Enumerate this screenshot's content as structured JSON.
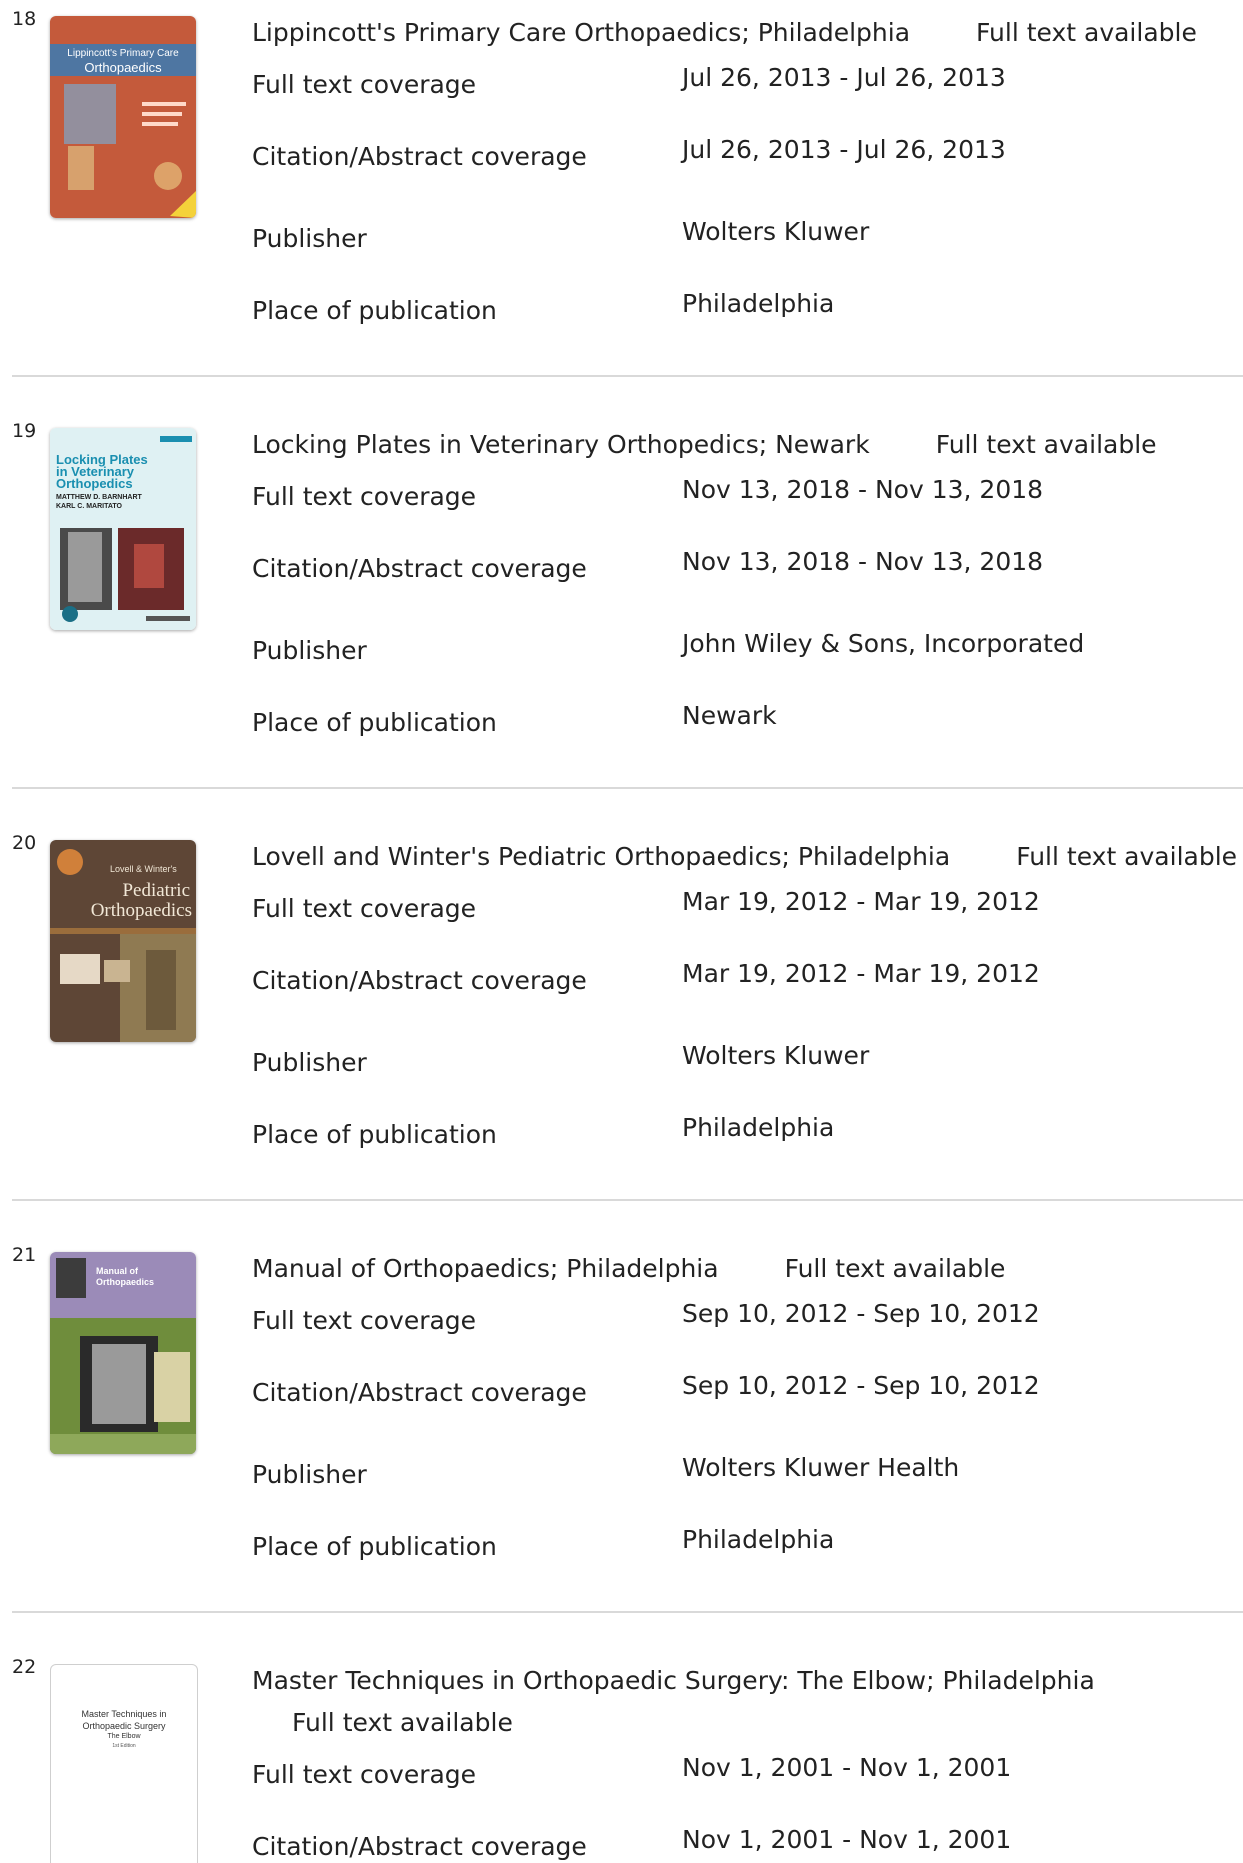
{
  "records": [
    {
      "number": "18",
      "title": "Lippincott's Primary Care Orthopaedics; Philadelphia",
      "availability": "Full text available",
      "fields": {
        "full_text_label": "Full text coverage",
        "full_text_value": "Jul 26, 2013 - Jul 26, 2013",
        "citation_label": "Citation/Abstract coverage",
        "citation_value": "Jul 26, 2013 - Jul 26, 2013",
        "publisher_label": "Publisher",
        "publisher_value": "Wolters Kluwer",
        "place_label": "Place of publication",
        "place_value": "Philadelphia"
      },
      "cover": {
        "line1": "Lippincott's Primary Care",
        "line2": "Orthopaedics",
        "colors": [
          "#c45a3b",
          "#2f6fa8"
        ]
      }
    },
    {
      "number": "19",
      "title": "Locking Plates in Veterinary Orthopedics; Newark",
      "availability": "Full text available",
      "fields": {
        "full_text_label": "Full text coverage",
        "full_text_value": "Nov 13, 2018 - Nov 13, 2018",
        "citation_label": "Citation/Abstract coverage",
        "citation_value": "Nov 13, 2018 - Nov 13, 2018",
        "publisher_label": "Publisher",
        "publisher_value": "John Wiley & Sons, Incorporated",
        "place_label": "Place of publication",
        "place_value": "Newark"
      },
      "cover": {
        "line1": "Locking Plates",
        "line2": "in Veterinary",
        "line3": "Orthopedics",
        "authors1": "MATTHEW D. BARNHART",
        "authors2": "KARL C. MARITATO",
        "colors": [
          "#dff1f3",
          "#1a8fb0"
        ]
      }
    },
    {
      "number": "20",
      "title": "Lovell and Winter's Pediatric Orthopaedics; Philadelphia",
      "availability": "Full text available",
      "fields": {
        "full_text_label": "Full text coverage",
        "full_text_value": "Mar 19, 2012 - Mar 19, 2012",
        "citation_label": "Citation/Abstract coverage",
        "citation_value": "Mar 19, 2012 - Mar 19, 2012",
        "publisher_label": "Publisher",
        "publisher_value": "Wolters Kluwer",
        "place_label": "Place of publication",
        "place_value": "Philadelphia"
      },
      "cover": {
        "line1": "Lovell & Winter's",
        "line2": "Pediatric",
        "line3": "Orthopaedics",
        "colors": [
          "#5e4636",
          "#8f7a52"
        ]
      }
    },
    {
      "number": "21",
      "title": "Manual of Orthopaedics; Philadelphia",
      "availability": "Full text available",
      "fields": {
        "full_text_label": "Full text coverage",
        "full_text_value": "Sep 10, 2012 - Sep 10, 2012",
        "citation_label": "Citation/Abstract coverage",
        "citation_value": "Sep 10, 2012 - Sep 10, 2012",
        "publisher_label": "Publisher",
        "publisher_value": "Wolters Kluwer Health",
        "place_label": "Place of publication",
        "place_value": "Philadelphia"
      },
      "cover": {
        "line1": "Manual of",
        "line2": "Orthopaedics",
        "colors": [
          "#9b8bb8",
          "#6f8d3c"
        ]
      }
    },
    {
      "number": "22",
      "title": "Master Techniques in Orthopaedic Surgery: The Elbow; Philadelphia",
      "availability": "Full text available",
      "fields": {
        "full_text_label": "Full text coverage",
        "full_text_value": "Nov 1, 2001 - Nov 1, 2001",
        "citation_label": "Citation/Abstract coverage",
        "citation_value": "Nov 1, 2001 - Nov 1, 2001"
      },
      "cover": {
        "line1": "Master Techniques in",
        "line2": "Orthopaedic Surgery",
        "line3": "The Elbow",
        "line4": "1st Edition"
      }
    }
  ]
}
